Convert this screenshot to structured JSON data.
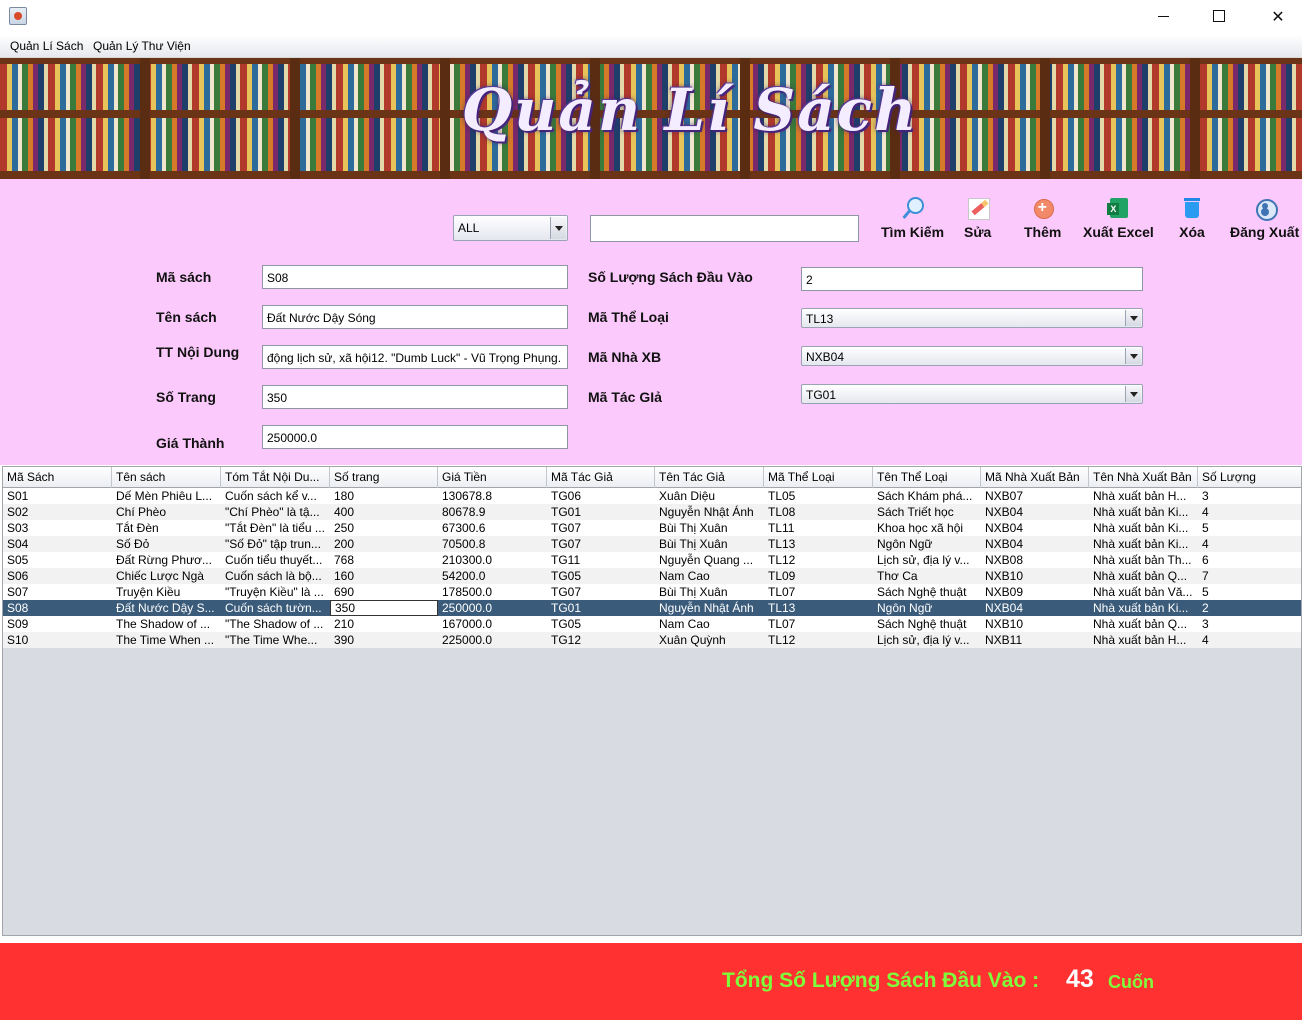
{
  "menu": [
    "Quản Lí Sách",
    "Quản Lý Thư Viện"
  ],
  "banner_title": "Quản Lí Sách",
  "search": {
    "filter": "ALL",
    "query": ""
  },
  "toolbar": [
    {
      "label": "Tìm Kiếm",
      "icon": "search-icon"
    },
    {
      "label": "Sửa",
      "icon": "edit-icon"
    },
    {
      "label": "Thêm",
      "icon": "add-icon"
    },
    {
      "label": "Xuất Excel",
      "icon": "excel-icon"
    },
    {
      "label": "Xóa",
      "icon": "trash-icon"
    },
    {
      "label": "Đăng Xuất",
      "icon": "user-icon"
    }
  ],
  "form": {
    "ma_sach": {
      "label": "Mã sách",
      "value": "S08"
    },
    "ten_sach": {
      "label": "Tên sách",
      "value": "Đất Nước Dậy Sóng"
    },
    "tt_noi_dung": {
      "label": "TT Nội Dung",
      "value": "động lịch sử, xã hội12. \"Dumb Luck\" - Vũ Trọng Phụng."
    },
    "so_trang": {
      "label": "Số Trang",
      "value": "350"
    },
    "gia_thanh": {
      "label": "Giá Thành",
      "value": "250000.0"
    },
    "so_luong": {
      "label": "Số Lượng Sách Đầu Vào",
      "value": "2"
    },
    "ma_the_loai": {
      "label": "Mã Thể Loại",
      "value": "TL13"
    },
    "ma_nha_xb": {
      "label": "Mã Nhà XB",
      "value": "NXB04"
    },
    "ma_tac_gia": {
      "label": "Mã Tác GIả",
      "value": "TG01"
    }
  },
  "table": {
    "columns": [
      "Mã Sách",
      "Tên sách",
      "Tóm Tắt Nội Du...",
      "Số trang",
      "Giá Tiền",
      "Mã Tác Giả",
      "Tên Tác Giả",
      "Mã Thể Loại",
      "Tên Thể Loại",
      "Mã Nhà Xuất Bản",
      "Tên Nhà Xuất Bản",
      "Số Lượng"
    ],
    "selected_index": 7,
    "rows": [
      [
        "S01",
        "Dế Mèn Phiêu L...",
        "Cuốn sách kể v...",
        "180",
        "130678.8",
        "TG06",
        "Xuân Diệu",
        "TL05",
        "Sách Khám phá...",
        "NXB07",
        "Nhà xuất bản H...",
        "3"
      ],
      [
        "S02",
        "Chí Phèo",
        "\"Chí Phèo\" là tậ...",
        "400",
        "80678.9",
        "TG01",
        "Nguyễn Nhật Ánh",
        "TL08",
        "Sách Triết học",
        "NXB04",
        "Nhà xuất bản Ki...",
        "4"
      ],
      [
        "S03",
        "Tắt Đèn",
        "\"Tắt Đèn\" là tiểu ...",
        "250",
        "67300.6",
        "TG07",
        "Bùi Thị Xuân",
        "TL11",
        "Khoa học xã hội",
        "NXB04",
        "Nhà xuất bản Ki...",
        "5"
      ],
      [
        "S04",
        "Số Đỏ",
        "\"Số Đỏ\" tập trun...",
        "200",
        "70500.8",
        "TG07",
        "Bùi Thị Xuân",
        "TL13",
        "Ngôn Ngữ",
        "NXB04",
        "Nhà xuất bản Ki...",
        "4"
      ],
      [
        "S05",
        "Đất Rừng Phươ...",
        "Cuốn tiểu thuyết...",
        "768",
        "210300.0",
        "TG11",
        "Nguyễn Quang ...",
        "TL12",
        " Lịch sử, địa lý v...",
        "NXB08",
        "Nhà xuất bản Th...",
        "6"
      ],
      [
        "S06",
        "Chiếc Lược Ngà",
        "Cuốn sách là bộ...",
        "160",
        "54200.0",
        "TG05",
        "Nam Cao",
        "TL09",
        "Thơ Ca",
        "NXB10",
        "Nhà xuất bản Q...",
        "7"
      ],
      [
        "S07",
        "Truyện Kiều",
        "\"Truyện Kiều\" là ...",
        "690",
        "178500.0",
        "TG07",
        "Bùi Thị Xuân",
        "TL07",
        "Sách Nghệ thuật",
        "NXB09",
        "Nhà xuất bản Vă...",
        "5"
      ],
      [
        "S08",
        "Đất Nước Dậy S...",
        "Cuốn sách tườn...",
        "350",
        "250000.0",
        "TG01",
        "Nguyễn Nhật Ánh",
        "TL13",
        "Ngôn Ngữ",
        "NXB04",
        "Nhà xuất bản Ki...",
        "2"
      ],
      [
        "S09",
        "The Shadow of ...",
        "\"The Shadow of ...",
        "210",
        "167000.0",
        "TG05",
        "Nam Cao",
        "TL07",
        "Sách Nghệ thuật",
        "NXB10",
        "Nhà xuất bản Q...",
        "3"
      ],
      [
        "S10",
        "The Time When ...",
        "\"The Time Whe...",
        "390",
        "225000.0",
        "TG12",
        "Xuân Quỳnh",
        "TL12",
        " Lịch sử, địa lý v...",
        "NXB11",
        "Nhà xuất bản H...",
        "4"
      ]
    ]
  },
  "footer": {
    "label": "Tổng Số Lượng Sách Đầu Vào :",
    "value": "43",
    "unit": "Cuốn"
  }
}
